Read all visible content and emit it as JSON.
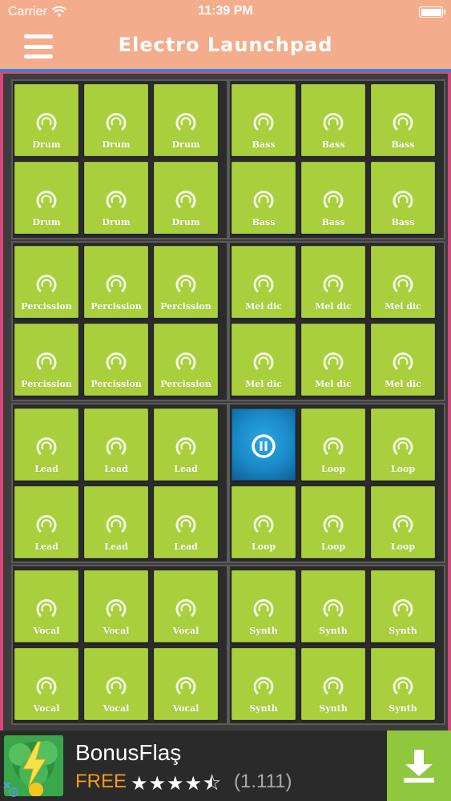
{
  "status_bar": {
    "carrier": "Carrier",
    "time": "11:39 PM"
  },
  "nav": {
    "title": "Electro Launchpad",
    "menu_icon": "hamburger-menu-icon"
  },
  "colors": {
    "header": "#f4ad8c",
    "pad": "#a9cf3d",
    "pad_active": "#1a88c6",
    "board": "#3d3d3d",
    "border_accent": "#d9487a",
    "ad_free": "#f29a1e",
    "ad_download": "#8fc83e"
  },
  "pads": {
    "icon": "loop-circle-icon",
    "active_icon": "pause-circle-icon",
    "labels": {
      "drum": "Drum",
      "bass": "Bass",
      "percussion": "Percission",
      "melodic": "Mel dic",
      "lead": "Lead",
      "loop": "Loop",
      "vocal": "Vocal",
      "synth": "Synth"
    }
  },
  "ad": {
    "app_name": "BonusFlaş",
    "price": "FREE",
    "stars": "★★★★⯪",
    "rating_value": 4.5,
    "review_count": "(1.111)",
    "download_icon": "download-icon",
    "close_icon": "adchoices-close-icon"
  }
}
